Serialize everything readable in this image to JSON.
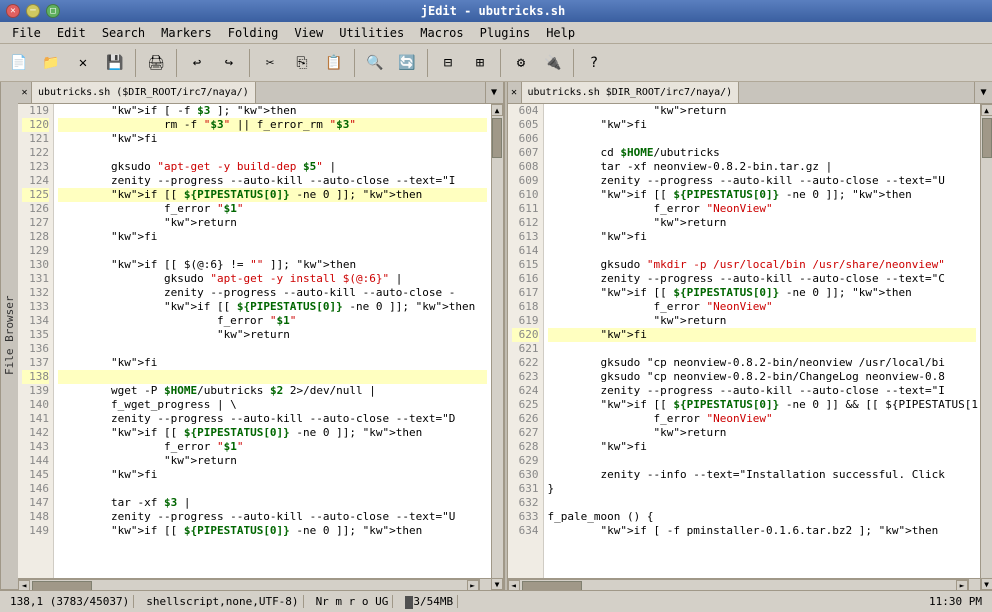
{
  "titleBar": {
    "title": "jEdit - ubutricks.sh",
    "closeBtn": "✕",
    "minBtn": "─",
    "maxBtn": "□"
  },
  "menuBar": {
    "items": [
      "File",
      "Edit",
      "Search",
      "Markers",
      "Folding",
      "View",
      "Utilities",
      "Macros",
      "Plugins",
      "Help"
    ]
  },
  "toolbar": {
    "buttons": [
      {
        "name": "new",
        "icon": "📄"
      },
      {
        "name": "open",
        "icon": "📁"
      },
      {
        "name": "close",
        "icon": "✕"
      },
      {
        "name": "save",
        "icon": "💾"
      },
      {
        "name": "print",
        "icon": "🖨"
      },
      {
        "name": "undo",
        "icon": "↩"
      },
      {
        "name": "redo",
        "icon": "↪"
      },
      {
        "name": "cut",
        "icon": "✂"
      },
      {
        "name": "copy",
        "icon": "⎘"
      },
      {
        "name": "paste",
        "icon": "📋"
      },
      {
        "name": "search",
        "icon": "🔍"
      },
      {
        "name": "replace",
        "icon": "🔄"
      },
      {
        "name": "split-h",
        "icon": "⊟"
      },
      {
        "name": "split-v",
        "icon": "⊞"
      },
      {
        "name": "settings",
        "icon": "⚙"
      },
      {
        "name": "plugin-mgr",
        "icon": "🔌"
      },
      {
        "name": "help",
        "icon": "?"
      }
    ]
  },
  "pane1": {
    "tab": "ubutricks.sh ($DIR_ROOT/irc7/naya/)",
    "lines": [
      {
        "num": "119",
        "text": "        if [ -f $3 ]; then",
        "hl": ""
      },
      {
        "num": "120",
        "text": "                rm -f \"$3\" || f_error_rm \"$3\"",
        "hl": "yellow"
      },
      {
        "num": "121",
        "text": "        fi",
        "hl": ""
      },
      {
        "num": "122",
        "text": "",
        "hl": ""
      },
      {
        "num": "123",
        "text": "        gksudo \"apt-get -y build-dep $5\" |",
        "hl": ""
      },
      {
        "num": "124",
        "text": "        zenity --progress --auto-kill --auto-close --text=\"I",
        "hl": ""
      },
      {
        "num": "125",
        "text": "        if [[ ${PIPESTATUS[0]} -ne 0 ]]; then",
        "hl": "yellow"
      },
      {
        "num": "126",
        "text": "                f_error \"$1\"",
        "hl": ""
      },
      {
        "num": "127",
        "text": "                return",
        "hl": ""
      },
      {
        "num": "128",
        "text": "        fi",
        "hl": ""
      },
      {
        "num": "129",
        "text": "",
        "hl": ""
      },
      {
        "num": "130",
        "text": "        if [[ $(@:6} != \"\" ]]; then",
        "hl": ""
      },
      {
        "num": "131",
        "text": "                gksudo \"apt-get -y install $(@:6}\" |",
        "hl": ""
      },
      {
        "num": "132",
        "text": "                zenity --progress --auto-kill --auto-close -",
        "hl": ""
      },
      {
        "num": "133",
        "text": "                if [[ ${PIPESTATUS[0]} -ne 0 ]]; then",
        "hl": ""
      },
      {
        "num": "134",
        "text": "                        f_error \"$1\"",
        "hl": ""
      },
      {
        "num": "135",
        "text": "                        return",
        "hl": ""
      },
      {
        "num": "136",
        "text": "",
        "hl": ""
      },
      {
        "num": "137",
        "text": "        fi",
        "hl": ""
      },
      {
        "num": "138",
        "text": "",
        "hl": "yellow"
      },
      {
        "num": "139",
        "text": "        wget -P $HOME/ubutricks $2 2>/dev/null |",
        "hl": ""
      },
      {
        "num": "140",
        "text": "        f_wget_progress | \\",
        "hl": ""
      },
      {
        "num": "141",
        "text": "        zenity --progress --auto-kill --auto-close --text=\"D",
        "hl": ""
      },
      {
        "num": "142",
        "text": "        if [[ ${PIPESTATUS[0]} -ne 0 ]]; then",
        "hl": ""
      },
      {
        "num": "143",
        "text": "                f_error \"$1\"",
        "hl": ""
      },
      {
        "num": "144",
        "text": "                return",
        "hl": ""
      },
      {
        "num": "145",
        "text": "        fi",
        "hl": ""
      },
      {
        "num": "146",
        "text": "",
        "hl": ""
      },
      {
        "num": "147",
        "text": "        tar -xf $3 |",
        "hl": ""
      },
      {
        "num": "148",
        "text": "        zenity --progress --auto-kill --auto-close --text=\"U",
        "hl": ""
      },
      {
        "num": "149",
        "text": "        if [[ ${PIPESTATUS[0]} -ne 0 ]]; then",
        "hl": ""
      }
    ]
  },
  "pane2": {
    "tab": "ubutricks.sh $DIR_ROOT/irc7/naya/)",
    "lines": [
      {
        "num": "604",
        "text": "                return",
        "hl": ""
      },
      {
        "num": "605",
        "text": "        fi",
        "hl": ""
      },
      {
        "num": "606",
        "text": "",
        "hl": ""
      },
      {
        "num": "607",
        "text": "        cd $HOME/ubutricks",
        "hl": ""
      },
      {
        "num": "608",
        "text": "        tar -xf neonview-0.8.2-bin.tar.gz |",
        "hl": ""
      },
      {
        "num": "609",
        "text": "        zenity --progress --auto-kill --auto-close --text=\"U",
        "hl": ""
      },
      {
        "num": "610",
        "text": "        if [[ ${PIPESTATUS[0]} -ne 0 ]]; then",
        "hl": ""
      },
      {
        "num": "611",
        "text": "                f_error \"NeonView\"",
        "hl": ""
      },
      {
        "num": "612",
        "text": "                return",
        "hl": ""
      },
      {
        "num": "613",
        "text": "        fi",
        "hl": ""
      },
      {
        "num": "614",
        "text": "",
        "hl": ""
      },
      {
        "num": "615",
        "text": "        gksudo \"mkdir -p /usr/local/bin /usr/share/neonview\"",
        "hl": ""
      },
      {
        "num": "616",
        "text": "        zenity --progress --auto-kill --auto-close --text=\"C",
        "hl": ""
      },
      {
        "num": "617",
        "text": "        if [[ ${PIPESTATUS[0]} -ne 0 ]]; then",
        "hl": ""
      },
      {
        "num": "618",
        "text": "                f_error \"NeonView\"",
        "hl": ""
      },
      {
        "num": "619",
        "text": "                return",
        "hl": ""
      },
      {
        "num": "620",
        "text": "        fi",
        "hl": "yellow"
      },
      {
        "num": "621",
        "text": "",
        "hl": ""
      },
      {
        "num": "622",
        "text": "        gksudo \"cp neonview-0.8.2-bin/neonview /usr/local/bi",
        "hl": ""
      },
      {
        "num": "623",
        "text": "        gksudo \"cp neonview-0.8.2-bin/ChangeLog neonview-0.8",
        "hl": ""
      },
      {
        "num": "624",
        "text": "        zenity --progress --auto-kill --auto-close --text=\"I",
        "hl": ""
      },
      {
        "num": "625",
        "text": "        if [[ ${PIPESTATUS[0]} -ne 0 ]] && [[ ${PIPESTATUS[1",
        "hl": ""
      },
      {
        "num": "626",
        "text": "                f_error \"NeonView\"",
        "hl": ""
      },
      {
        "num": "627",
        "text": "                return",
        "hl": ""
      },
      {
        "num": "628",
        "text": "        fi",
        "hl": ""
      },
      {
        "num": "629",
        "text": "",
        "hl": ""
      },
      {
        "num": "630",
        "text": "        zenity --info --text=\"Installation successful. Click",
        "hl": ""
      },
      {
        "num": "631",
        "text": "}",
        "hl": ""
      },
      {
        "num": "632",
        "text": "",
        "hl": ""
      },
      {
        "num": "633",
        "text": "f_pale_moon () {",
        "hl": ""
      },
      {
        "num": "634",
        "text": "        if [ -f pminstaller-0.1.6.tar.bz2 ]; then",
        "hl": ""
      }
    ]
  },
  "statusBar": {
    "position": "138,1",
    "info": "(3783/45037)",
    "fileType": "shellscript,none,UTF-8)",
    "mode": "Nr m r o UG",
    "memory": "3/54MB",
    "time": "11:30 PM"
  }
}
